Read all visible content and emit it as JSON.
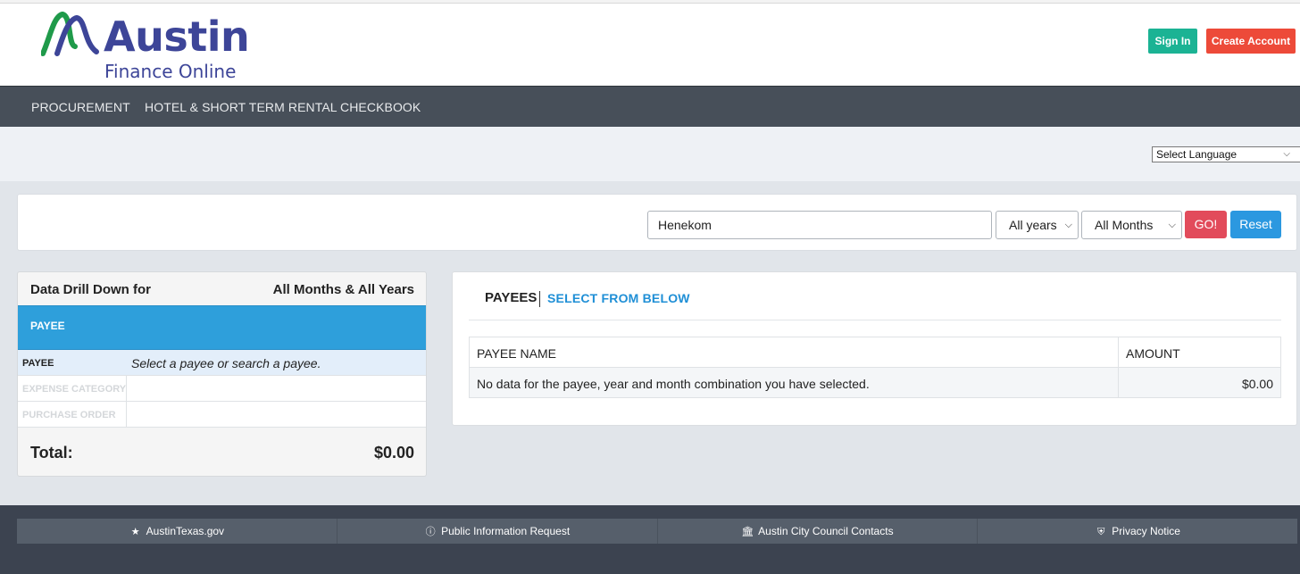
{
  "brand": {
    "title": "Austin",
    "subtitle": "Finance Online",
    "primary_color": "#3d4598",
    "accent_color": "#1f9a4a"
  },
  "header": {
    "sign_in_label": "Sign In",
    "create_account_label": "Create Account"
  },
  "nav": {
    "items": [
      {
        "label": "PROCUREMENT"
      },
      {
        "label": "HOTEL & SHORT TERM RENTAL"
      },
      {
        "label": "CHECKBOOK"
      }
    ]
  },
  "language": {
    "selected": "Select Language"
  },
  "search": {
    "query": "Henekom",
    "year": "All years",
    "month": "All Months",
    "go_label": "GO!",
    "reset_label": "Reset"
  },
  "drilldown": {
    "title": "Data Drill Down for",
    "period": "All Months & All Years",
    "band_label": "PAYEE",
    "rows": [
      {
        "key": "PAYEE",
        "value": "Select a payee or search a payee."
      },
      {
        "key": "EXPENSE CATEGORY",
        "value": ""
      },
      {
        "key": "PURCHASE ORDER",
        "value": ""
      }
    ],
    "total_label": "Total:",
    "total_value": "$0.00"
  },
  "payees": {
    "title": "PAYEES",
    "subtitle": "SELECT FROM BELOW",
    "columns": [
      "PAYEE NAME",
      "AMOUNT"
    ],
    "rows": [
      {
        "name": "No data for the payee, year and month combination you have selected.",
        "amount": "$0.00"
      }
    ]
  },
  "footer": {
    "links": [
      {
        "label": "AustinTexas.gov",
        "icon": "star-icon"
      },
      {
        "label": "Public Information Request",
        "icon": "info-icon"
      },
      {
        "label": "Austin City Council Contacts",
        "icon": "institution-icon"
      },
      {
        "label": "Privacy Notice",
        "icon": "shield-icon"
      }
    ]
  }
}
